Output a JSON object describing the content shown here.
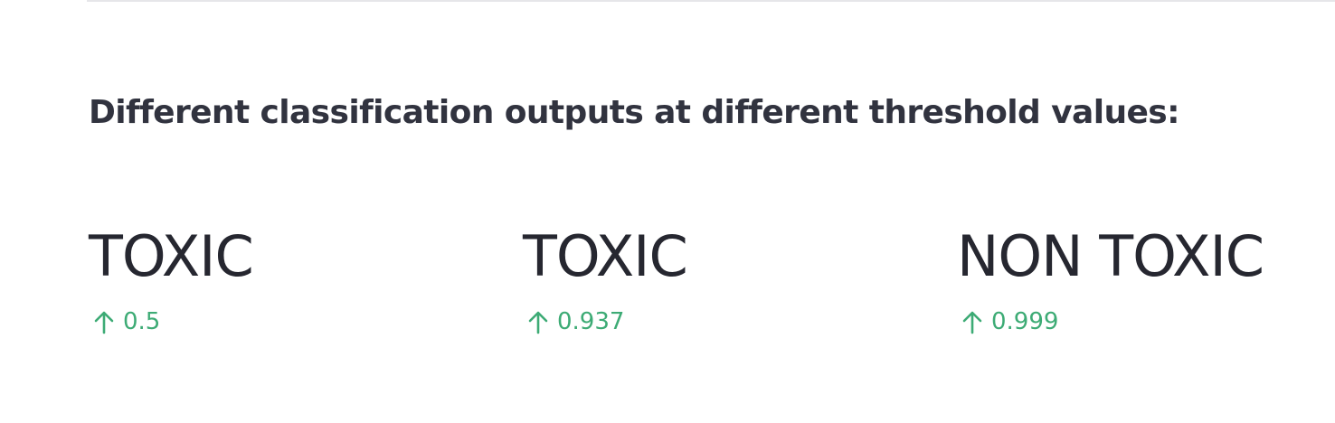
{
  "section": {
    "heading": "Different classification outputs at different threshold values:"
  },
  "metrics": [
    {
      "label": "TOXIC",
      "delta": "0.5",
      "delta_direction": "up",
      "delta_color": "#3dab75"
    },
    {
      "label": "TOXIC",
      "delta": "0.937",
      "delta_direction": "up",
      "delta_color": "#3dab75"
    },
    {
      "label": "NON TOXIC",
      "delta": "0.999",
      "delta_direction": "up",
      "delta_color": "#3dab75"
    }
  ],
  "icons": {
    "delta": "arrow-up-icon"
  }
}
